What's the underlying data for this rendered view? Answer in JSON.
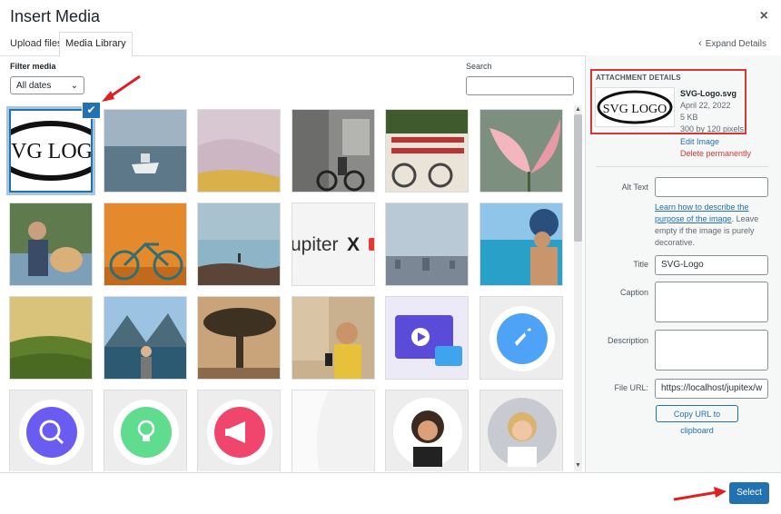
{
  "modal": {
    "title": "Insert Media",
    "close": "×"
  },
  "tabs": [
    {
      "label": "Upload files",
      "active": false
    },
    {
      "label": "Media Library",
      "active": true
    }
  ],
  "expand_details": "Expand Details",
  "filter": {
    "label": "Filter media",
    "selected": "All dates",
    "caret": "⌄"
  },
  "search": {
    "label": "Search",
    "value": ""
  },
  "grid": {
    "tiles": [
      {
        "name": "svg-logo",
        "text": "VG LOG",
        "selected": true
      },
      {
        "name": "boat"
      },
      {
        "name": "sand-dunes"
      },
      {
        "name": "street-cyclist"
      },
      {
        "name": "bicycle-house"
      },
      {
        "name": "pink-flower"
      },
      {
        "name": "man-with-dog"
      },
      {
        "name": "orange-bicycle"
      },
      {
        "name": "rock-sunset"
      },
      {
        "name": "jupiterx-logo",
        "text": "upiter",
        "accent": "X"
      },
      {
        "name": "city-skyline"
      },
      {
        "name": "pool-woman"
      },
      {
        "name": "rice-terraces"
      },
      {
        "name": "mountain-lake-woman"
      },
      {
        "name": "savanna-tree"
      },
      {
        "name": "woman-selfie"
      },
      {
        "name": "video-illustration"
      },
      {
        "name": "rocket-circle"
      },
      {
        "name": "search-chart-circle"
      },
      {
        "name": "lightbulb-circle"
      },
      {
        "name": "megaphone-circle"
      },
      {
        "name": "placeholder"
      },
      {
        "name": "avatar-woman-curly"
      },
      {
        "name": "avatar-woman-blonde"
      }
    ],
    "check_mark": "✔"
  },
  "attachment": {
    "heading": "ATTACHMENT DETAILS",
    "thumb_text": "SVG LOGO",
    "filename": "SVG-Logo.svg",
    "date": "April 22, 2022",
    "size": "5 KB",
    "dimensions": "300 by 120 pixels",
    "edit_link": "Edit Image",
    "delete_link": "Delete permanently"
  },
  "fields": {
    "alt_label": "Alt Text",
    "alt_value": "",
    "help_link": "Learn how to describe the purpose of the image",
    "help_rest": ". Leave empty if the image is purely decorative.",
    "title_label": "Title",
    "title_value": "SVG-Logo",
    "caption_label": "Caption",
    "caption_value": "",
    "description_label": "Description",
    "description_value": "",
    "url_label": "File URL:",
    "url_value": "https://localhost/jupitex/w",
    "copy_button": "Copy URL to clipboard"
  },
  "footer": {
    "select_button": "Select"
  },
  "colors": {
    "accent": "#2271b1",
    "danger": "#d63638",
    "arrow": "#e02020"
  }
}
